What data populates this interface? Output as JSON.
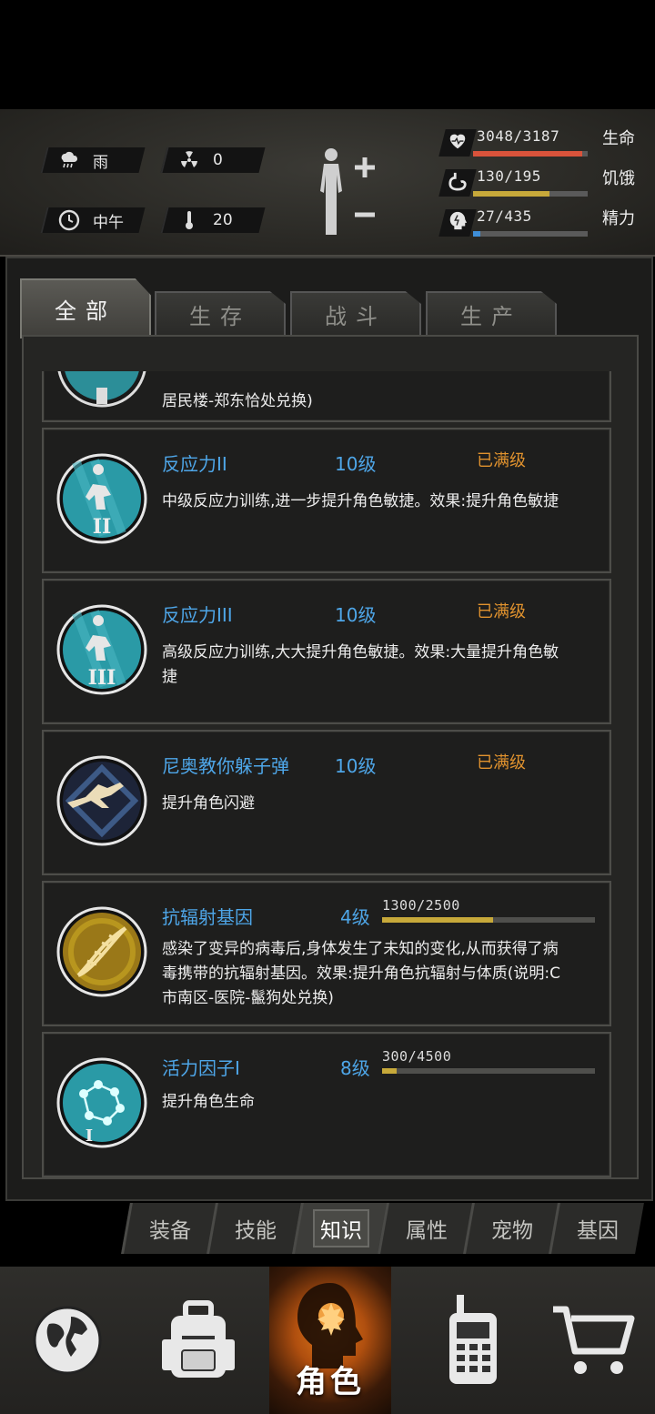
{
  "status": {
    "weather": "雨",
    "radiation": "0",
    "time": "中午",
    "temperature": "20",
    "health": {
      "value": "3048/3187",
      "label": "生命",
      "fraction": 0.956,
      "color": "#d9533b"
    },
    "hunger": {
      "value": "130/195",
      "label": "饥饿",
      "fraction": 0.667,
      "color": "#c7a93a"
    },
    "energy": {
      "value": "27/435",
      "label": "精力",
      "fraction": 0.062,
      "color": "#3f8fd8"
    }
  },
  "tabs": [
    "全部",
    "生存",
    "战斗",
    "生产"
  ],
  "active_tab": "全部",
  "partial_card_desc": "居民楼-郑东恰处兑换)",
  "skills": [
    {
      "name": "反应力II",
      "level": "10级",
      "status": "已满级",
      "desc": "中级反应力训练,进一步提升角色敏捷。效果:提升角色敏捷",
      "icon": "reflex-ii-icon"
    },
    {
      "name": "反应力III",
      "level": "10级",
      "status": "已满级",
      "desc": "高级反应力训练,大大提升角色敏捷。效果:大量提升角色敏捷",
      "icon": "reflex-iii-icon"
    },
    {
      "name": "尼奥教你躲子弹",
      "level": "10级",
      "status": "已满级",
      "desc": "提升角色闪避",
      "icon": "dodge-bullet-icon"
    },
    {
      "name": "抗辐射基因",
      "level": "4级",
      "progress": "1300/2500",
      "progress_fraction": 0.52,
      "desc": "感染了变异的病毒后,身体发生了未知的变化,从而获得了病毒携带的抗辐射基因。效果:提升角色抗辐射与体质(说明:C市南区-医院-鬣狗处兑换)",
      "icon": "dna-icon"
    },
    {
      "name": "活力因子I",
      "level": "8级",
      "progress": "300/4500",
      "progress_fraction": 0.067,
      "desc": "提升角色生命",
      "icon": "vitality-molecule-icon"
    }
  ],
  "subtabs": [
    "装备",
    "技能",
    "知识",
    "属性",
    "宠物",
    "基因"
  ],
  "active_subtab": "知识",
  "nav": {
    "role_label": "角色"
  }
}
